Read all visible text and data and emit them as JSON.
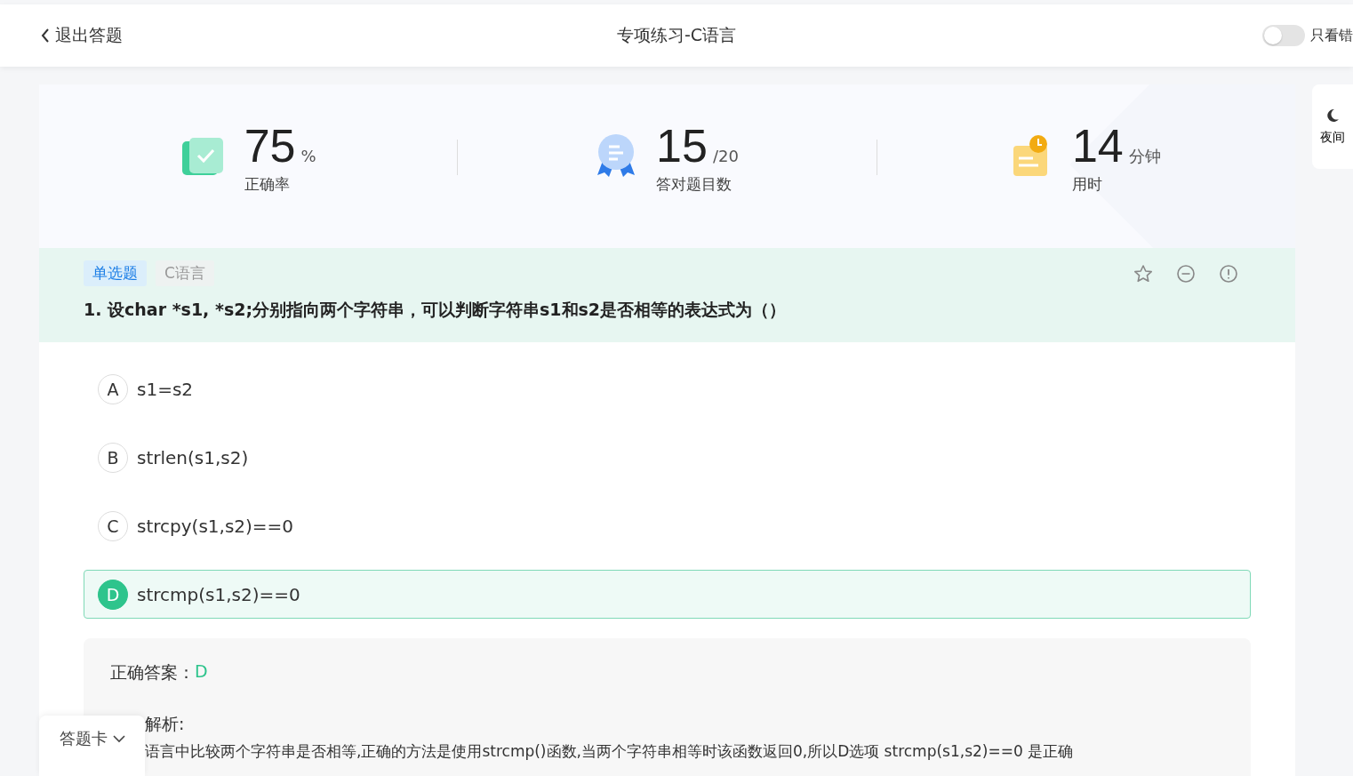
{
  "header": {
    "back_label": "退出答题",
    "title": "专项练习-C语言",
    "wrong_only": {
      "label": "只看错",
      "on": false
    }
  },
  "night_mode": {
    "label": "夜间"
  },
  "stats": [
    {
      "kind": "accuracy",
      "value": "75",
      "unit": "%",
      "label": "正确率"
    },
    {
      "kind": "score",
      "value": "15",
      "unit": "/20",
      "label": "答对题目数"
    },
    {
      "kind": "time",
      "value": "14",
      "unit": "分钟",
      "label": "用时"
    }
  ],
  "question": {
    "tags": [
      {
        "kind": "type",
        "label": "单选题"
      },
      {
        "kind": "subject",
        "label": "C语言"
      }
    ],
    "text": "1. 设char *s1, *s2;分别指向两个字符串，可以判断字符串s1和s2是否相等的表达式为（）",
    "options": [
      {
        "letter": "A",
        "text": "s1=s2",
        "selected": false
      },
      {
        "letter": "B",
        "text": "strlen(s1,s2)",
        "selected": false
      },
      {
        "letter": "C",
        "text": "strcpy(s1,s2)==0",
        "selected": false
      },
      {
        "letter": "D",
        "text": "strcmp(s1,s2)==0",
        "selected": true
      }
    ]
  },
  "answer": {
    "label": "正确答案：",
    "value": "D",
    "analysis_label": "解析:",
    "analysis_text": "语言中比较两个字符串是否相等,正确的方法是使用strcmp()函数,当两个字符串相等时该函数返回0,所以D选项 strcmp(s1,s2)==0 是正确"
  },
  "answer_card_button": {
    "label": "答题卡"
  }
}
